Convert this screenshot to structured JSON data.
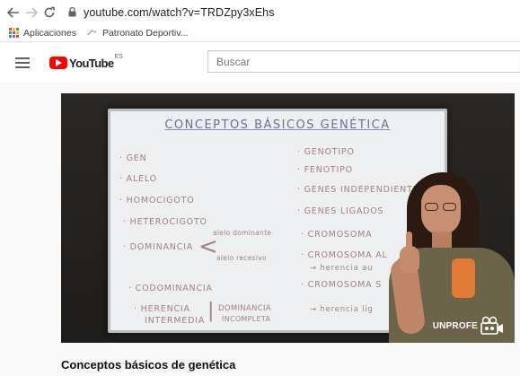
{
  "browser": {
    "url": "youtube.com/watch?v=TRDZpy3xEhs",
    "bookmarks": [
      {
        "label": "Aplicaciones",
        "icon": "apps-grid-icon"
      },
      {
        "label": "Patronato Deportiv...",
        "icon": "site-favicon-icon"
      }
    ]
  },
  "youtube": {
    "logo_text": "YouTube",
    "region": "ES",
    "search_placeholder": "Buscar"
  },
  "video": {
    "title": "Conceptos básicos de genética",
    "whiteboard": {
      "title": "CONCEPTOS BÁSICOS GENÉTICA",
      "left_items": [
        "· GEN",
        "· ALELO",
        "· HOMOCIGOTO",
        "· HETEROCIGOTO",
        "· DOMINANCIA",
        "· CODOMINANCIA",
        "· HERENCIA",
        "INTERMEDIA"
      ],
      "dominance_notes": [
        "alelo dominante",
        "alelo recesivo"
      ],
      "incomplete": [
        "DOMINANCIA",
        "INCOMPLETA"
      ],
      "right_items": [
        "· GENOTIPO",
        "· FENOTIPO",
        "· GENES INDEPENDIENTES",
        "· GENES LIGADOS",
        "· CROMOSOMA",
        "· CROMOSOMA AL",
        "→ herencia au",
        "· CROMOSOMA S",
        "→ herencia lig"
      ]
    },
    "watermark": "UNPROFE"
  },
  "colors": {
    "youtube_red": "#ff0000",
    "board_text": "#a08283",
    "board_title": "#6a6f9a"
  }
}
